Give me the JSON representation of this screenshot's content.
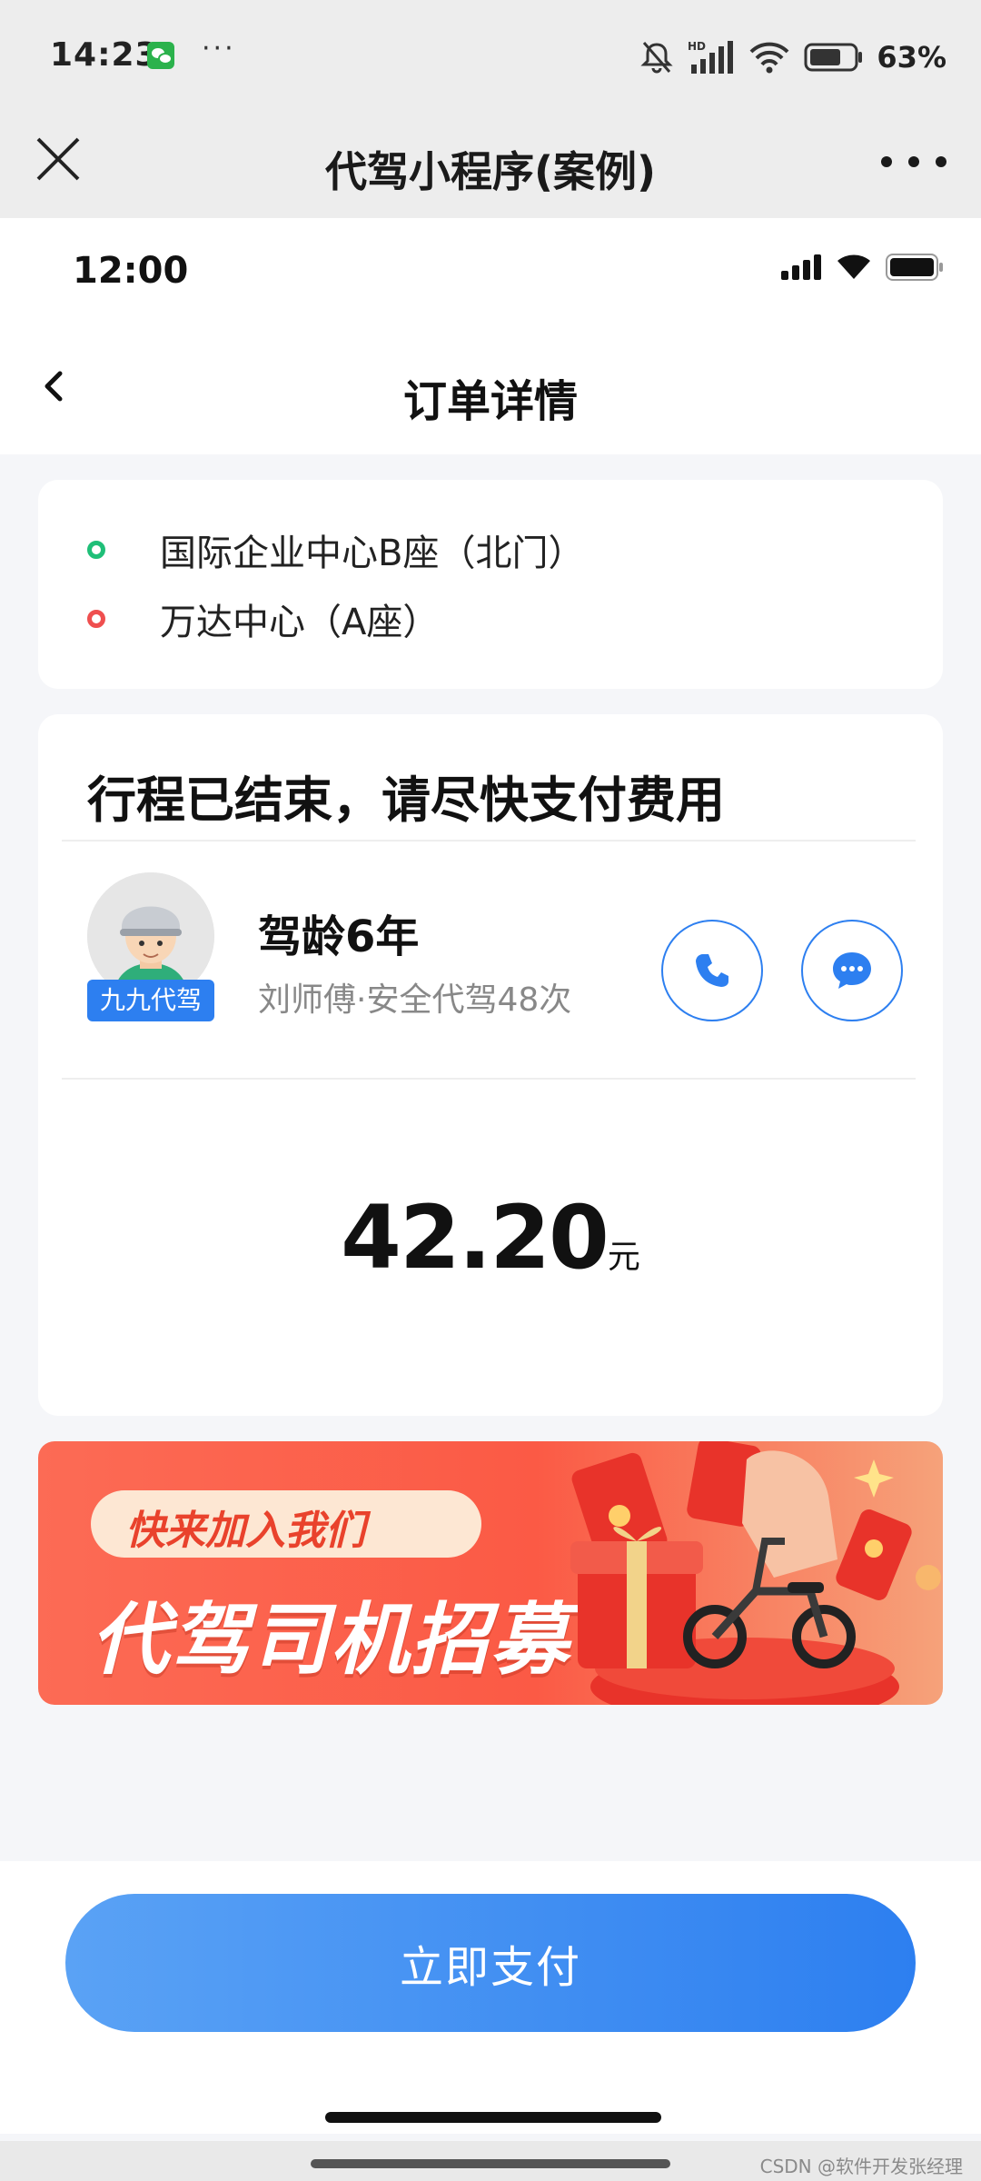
{
  "system_bar": {
    "time": "14:23",
    "more": "···",
    "battery_percent": "63%",
    "network": "HD"
  },
  "mini_program": {
    "title": "代驾小程序(案例)"
  },
  "inner_status": {
    "time": "12:00"
  },
  "page": {
    "title": "订单详情"
  },
  "route": {
    "start": "国际企业中心B座（北门）",
    "end": "万达中心（A座）"
  },
  "trip": {
    "status": "行程已结束，请尽快支付费用",
    "avatar_tag": "九九代驾",
    "driver_years": "驾龄6年",
    "driver_info": "刘师傅·安全代驾48次",
    "price": "42.20",
    "price_unit": "元"
  },
  "banner": {
    "sub_text": "快来加入我们",
    "main_text": "代驾司机招募"
  },
  "bottom": {
    "pay_label": "立即支付"
  },
  "watermark": "CSDN @软件开发张经理",
  "colors": {
    "accent": "#2d7ff0",
    "start_dot": "#1fbf78",
    "end_dot": "#ef4f4f",
    "banner": "#fb5a45"
  },
  "icons": [
    "wechat-icon",
    "mute-bell-icon",
    "signal-icon",
    "wifi-icon",
    "battery-icon",
    "close-icon",
    "more-icon",
    "back-icon",
    "phone-icon",
    "chat-icon"
  ]
}
